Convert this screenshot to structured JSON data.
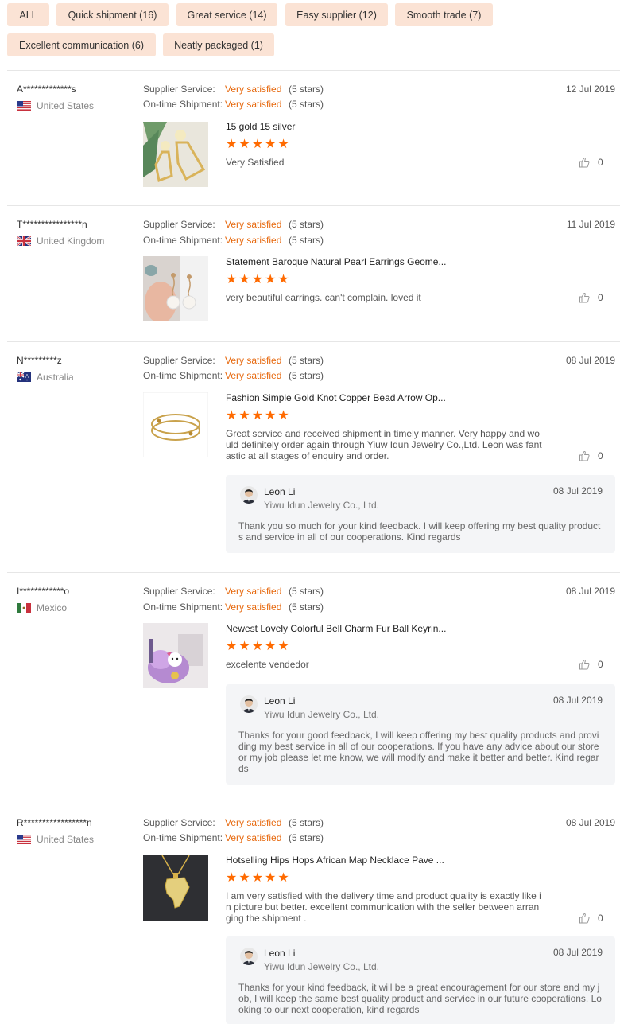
{
  "tags": [
    "ALL",
    "Quick shipment (16)",
    "Great service (14)",
    "Easy supplier (12)",
    "Smooth trade (7)",
    "Excellent communication (6)",
    "Neatly packaged (1)"
  ],
  "labels": {
    "supplier_service": "Supplier Service:",
    "ontime_shipment": "On-time Shipment:",
    "very_satisfied": "Very satisfied",
    "five_stars": "(5 stars)"
  },
  "colors": {
    "accent": "#ff6a00",
    "tag_bg": "#fbe3d5",
    "reply_bg": "#f4f5f7"
  },
  "reviews": [
    {
      "user": "A*************s",
      "country": "United States",
      "flag": "us-flag-icon",
      "date": "12 Jul 2019",
      "product": "15 gold 15 silver",
      "rating": 5,
      "text": "Very Satisfied",
      "likes": "0"
    },
    {
      "user": "T****************n",
      "country": "United Kingdom",
      "flag": "uk-flag-icon",
      "date": "11 Jul 2019",
      "product": "Statement Baroque Natural Pearl Earrings Geome...",
      "rating": 5,
      "text": "very beautiful earrings. can't complain. loved it",
      "likes": "0"
    },
    {
      "user": "N*********z",
      "country": "Australia",
      "flag": "au-flag-icon",
      "date": "08 Jul 2019",
      "product": "Fashion Simple Gold Knot Copper Bead Arrow Op...",
      "rating": 5,
      "text": "Great service and received shipment in timely manner. Very happy and would definitely order again through Yiuw Idun Jewelry Co.,Ltd. Leon was fantastic at all stages of enquiry and order.",
      "likes": "0",
      "reply": {
        "name": "Leon Li",
        "company": "Yiwu Idun Jewelry Co., Ltd.",
        "date": "08 Jul 2019",
        "text": "Thank you so much for your kind feedback. I will keep offering my best quality products and service in all of our cooperations. Kind regards"
      }
    },
    {
      "user": "I************o",
      "country": "Mexico",
      "flag": "mx-flag-icon",
      "date": "08 Jul 2019",
      "product": "Newest Lovely Colorful Bell Charm Fur Ball Keyrin...",
      "rating": 5,
      "text": "excelente vendedor",
      "likes": "0",
      "reply": {
        "name": "Leon Li",
        "company": "Yiwu Idun Jewelry Co., Ltd.",
        "date": "08 Jul 2019",
        "text": "Thanks for your good feedback, I will keep offering my best quality products and providing my best service in all of our cooperations. If you have any advice about our store or my job please let me know, we will modify and make it better and better. Kind regards"
      }
    },
    {
      "user": "R*****************n",
      "country": "United States",
      "flag": "us-flag-icon",
      "date": "08 Jul 2019",
      "product": "Hotselling Hips Hops African Map Necklace Pave ...",
      "rating": 5,
      "text": "I am very satisfied with the delivery time and product quality is exactly like in picture but better. excellent communication with the seller between arranging the shipment .",
      "likes": "0",
      "reply": {
        "name": "Leon Li",
        "company": "Yiwu Idun Jewelry Co., Ltd.",
        "date": "08 Jul 2019",
        "text": "Thanks for your kind feedback, it will be a great encouragement for our store and my job, I will keep the same best quality product and service in our future cooperations. Looking to our next cooperation, kind regards"
      }
    }
  ]
}
